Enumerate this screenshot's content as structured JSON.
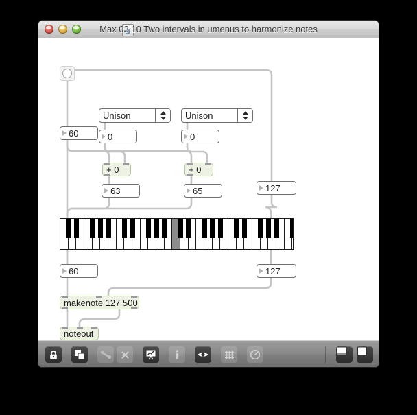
{
  "window": {
    "title": "Max 03.10 Two intervals in umenus to harmonize notes",
    "doc_icon": "max-patcher-icon",
    "lights": [
      {
        "name": "close-button",
        "color": "#e8564a"
      },
      {
        "name": "minimize-button",
        "color": "#f2bd42"
      },
      {
        "name": "zoom-button",
        "color": "#72c63f"
      }
    ]
  },
  "patch": {
    "bang": {
      "label": "",
      "icon": "bang-circle"
    },
    "umenus": [
      {
        "value": "Unison",
        "name": "interval-umenu-1"
      },
      {
        "value": "Unison",
        "name": "interval-umenu-2"
      }
    ],
    "number_boxes": {
      "root_note": "60",
      "interval_1": "0",
      "interval_2": "0",
      "result_1": "63",
      "result_2": "65",
      "velocity_top": "127",
      "note_out": "60",
      "velocity_out": "127"
    },
    "objects": {
      "add_1": "+ 0",
      "add_2": "+ 0",
      "makenote": "makenote 127 500",
      "noteout": "noteout"
    },
    "keyboard": {
      "name": "kslider-keyboard",
      "white_keys": 29,
      "selected_white_key_index": 14
    }
  },
  "toolbar": {
    "buttons": [
      {
        "name": "lock-toggle-button",
        "icon": "lock-icon",
        "state": "on"
      },
      {
        "name": "new-object-button",
        "icon": "new-object-icon",
        "state": "on"
      },
      {
        "name": "patchcords-button",
        "icon": "patchcords-icon",
        "state": "off"
      },
      {
        "name": "delete-button",
        "icon": "close-x-icon",
        "state": "off"
      },
      {
        "name": "presentation-button",
        "icon": "presentation-icon",
        "state": "on"
      },
      {
        "name": "inspector-info-button",
        "icon": "info-icon",
        "state": "off"
      },
      {
        "name": "inspector-button",
        "icon": "inspector-icon",
        "state": "on"
      },
      {
        "name": "grid-button",
        "icon": "grid-icon",
        "state": "off"
      },
      {
        "name": "assistance-button",
        "icon": "assistance-icon",
        "state": "off"
      }
    ],
    "view_buttons": [
      {
        "name": "sidebar-view-button",
        "icon": "split-view-icon"
      },
      {
        "name": "full-view-button",
        "icon": "full-view-icon"
      }
    ]
  },
  "colors": {
    "object_border": "#b4c79a",
    "object_fill": "#eef2e4",
    "cord": "#c4c4c4",
    "canvas": "#ffffff"
  }
}
